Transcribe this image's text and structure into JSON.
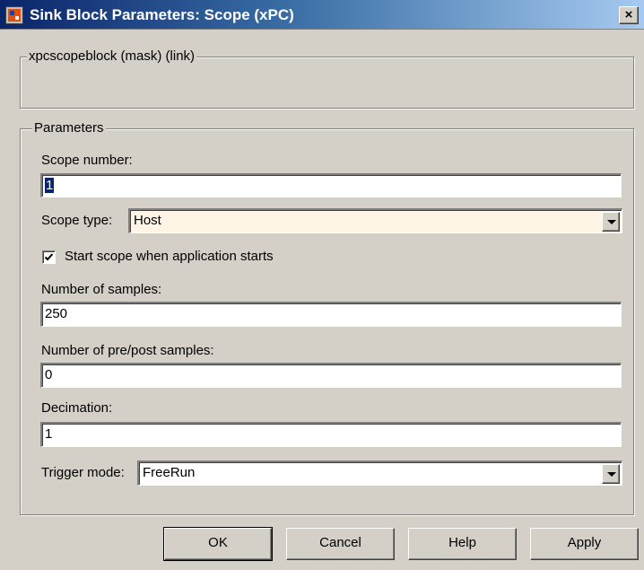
{
  "window": {
    "title": "Sink Block Parameters: Scope (xPC)",
    "close_glyph": "×"
  },
  "mask_group": {
    "legend": "xpcscopeblock (mask) (link)"
  },
  "parameters": {
    "legend": "Parameters",
    "scope_number_label": "Scope number:",
    "scope_number_value": "1",
    "scope_type_label": "Scope type:",
    "scope_type_value": "Host",
    "start_scope_label": "Start scope when application starts",
    "start_scope_checked": true,
    "num_samples_label": "Number of samples:",
    "num_samples_value": "250",
    "num_prepost_label": "Number of pre/post samples:",
    "num_prepost_value": "0",
    "decimation_label": "Decimation:",
    "decimation_value": "1",
    "trigger_mode_label": "Trigger mode:",
    "trigger_mode_value": "FreeRun"
  },
  "buttons": {
    "ok": "OK",
    "cancel": "Cancel",
    "help": "Help",
    "apply": "Apply"
  },
  "colors": {
    "dialog_bg": "#d4d0c8",
    "titlebar_start": "#0a246a",
    "titlebar_end": "#a6caf0",
    "highlighted_field_bg": "#fff5e6"
  },
  "icons": {
    "app": "simulink-block-icon",
    "close": "close-icon",
    "dropdown": "chevron-down-icon",
    "check": "checkmark-icon"
  }
}
